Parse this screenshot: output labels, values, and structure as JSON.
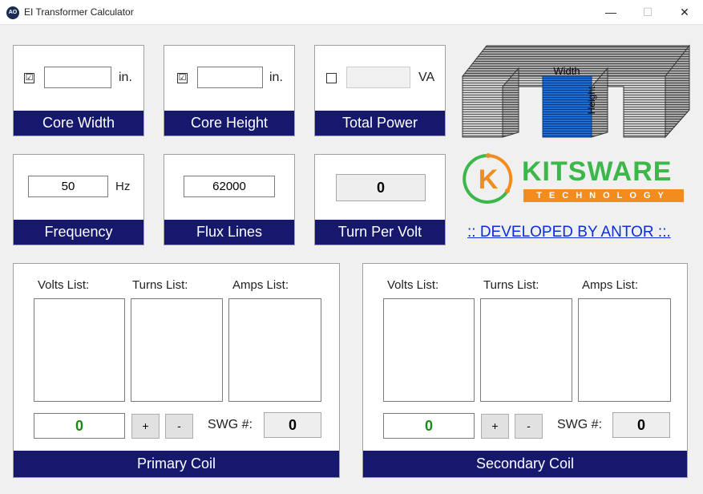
{
  "window": {
    "title": "EI Transformer Calculator",
    "icon_text": "AO",
    "minimize": "—",
    "maximize": "☐",
    "close": "✕"
  },
  "core_width": {
    "checked": "☑",
    "value": "",
    "unit": "in.",
    "caption": "Core Width"
  },
  "core_height": {
    "checked": "☑",
    "value": "",
    "unit": "in.",
    "caption": "Core Height"
  },
  "total_power": {
    "checked": "",
    "value": "",
    "unit": "VA",
    "caption": "Total Power"
  },
  "frequency": {
    "value": "50",
    "unit": "Hz",
    "caption": "Frequency"
  },
  "flux_lines": {
    "value": "62000",
    "caption": "Flux Lines"
  },
  "turn_per_volt": {
    "value": "0",
    "caption": "Turn Per Volt"
  },
  "core_image": {
    "width_label": "Width",
    "height_label": "Height",
    "accent_color": "#1a6fd6"
  },
  "logo": {
    "name": "KITSWARE",
    "subtitle": "TECHNOLOGY",
    "letter": "K",
    "green": "#3cb84a",
    "orange": "#f28c1e"
  },
  "developer_link": ":: DEVELOPED BY ANTOR ::.",
  "primary": {
    "volts_label": "Volts List:",
    "turns_label": "Turns List:",
    "amps_label": "Amps List:",
    "value": "0",
    "plus": "+",
    "minus": "-",
    "swg_label": "SWG #:",
    "swg_value": "0",
    "caption": "Primary Coil"
  },
  "secondary": {
    "volts_label": "Volts List:",
    "turns_label": "Turns List:",
    "amps_label": "Amps List:",
    "value": "0",
    "plus": "+",
    "minus": "-",
    "swg_label": "SWG #:",
    "swg_value": "0",
    "caption": "Secondary Coil"
  }
}
